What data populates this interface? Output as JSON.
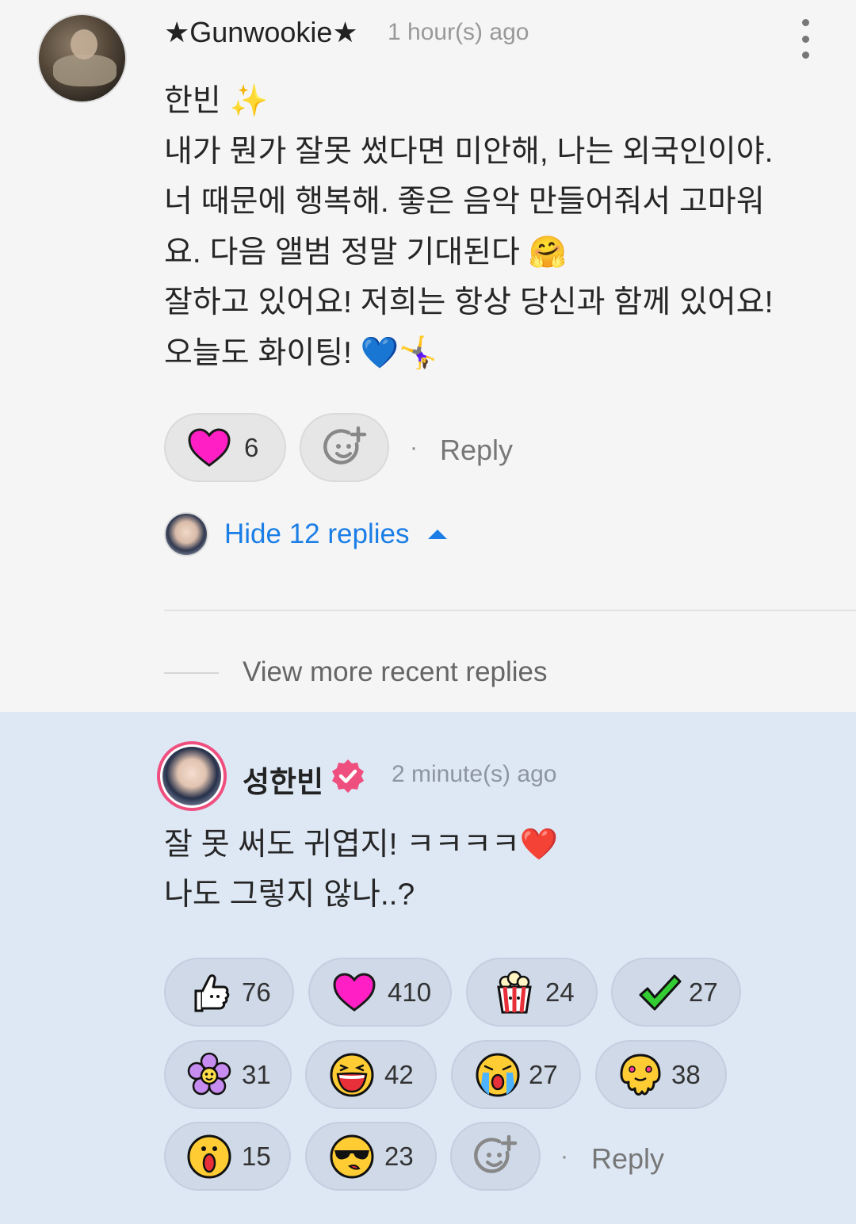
{
  "parent_comment": {
    "username": "★Gunwookie★",
    "time": "1 hour(s) ago",
    "body_lines": [
      "한빈 ✨",
      "내가 뭔가 잘못 썼다면 미안해, 나는 외국인이야.",
      "너 때문에 행복해. 좋은 음악 만들어줘서 고마워",
      "요. 다음 앨범 정말 기대된다 🤗",
      "잘하고 있어요! 저희는 항상 당신과 함께 있어요!",
      "오늘도 화이팅! 💙🤸‍♀️"
    ],
    "heart_count": "6",
    "reply_separator": "·",
    "reply_label": "Reply",
    "hide_replies_label": "Hide 12 replies",
    "view_more_label": "View more recent replies"
  },
  "artist_reply": {
    "username": "성한빈",
    "time": "2 minute(s) ago",
    "body_lines": [
      "잘 못 써도 귀엽지! ㅋㅋㅋㅋ❤️",
      "나도 그렇지 않나..?"
    ],
    "reactions": [
      {
        "icon": "thumbs-up-icon",
        "count": "76"
      },
      {
        "icon": "heart-icon",
        "count": "410"
      },
      {
        "icon": "popcorn-icon",
        "count": "24"
      },
      {
        "icon": "check-icon",
        "count": "27"
      },
      {
        "icon": "flower-icon",
        "count": "31"
      },
      {
        "icon": "laughing-face-icon",
        "count": "42"
      },
      {
        "icon": "crying-face-icon",
        "count": "27"
      },
      {
        "icon": "melting-face-icon",
        "count": "38"
      },
      {
        "icon": "surprised-face-icon",
        "count": "15"
      },
      {
        "icon": "sunglasses-face-icon",
        "count": "23"
      }
    ],
    "reply_separator": "·",
    "reply_label": "Reply"
  },
  "colors": {
    "link_blue": "#1a7ee6",
    "heart_pink": "#ff1fc4",
    "verified_pink": "#ef4f7f",
    "reply_bg": "#dee8f5"
  }
}
